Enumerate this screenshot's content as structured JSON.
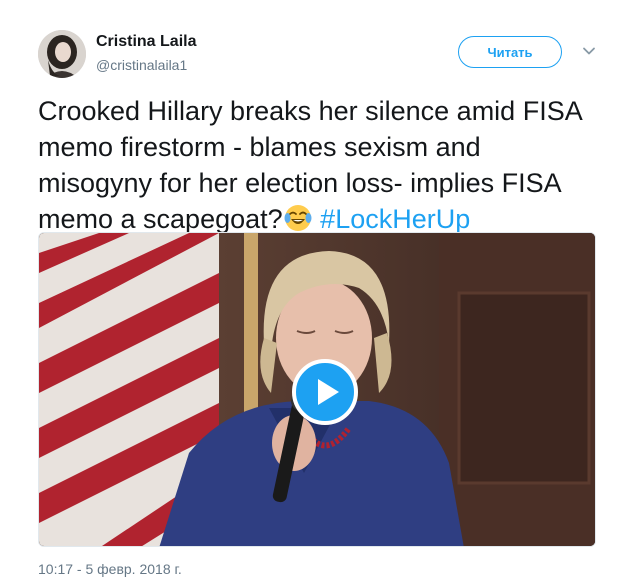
{
  "author": {
    "name": "Cristina Laila",
    "handle": "@cristinalaila1",
    "avatar_icon": "profile-photo"
  },
  "actions": {
    "follow_label": "Читать",
    "menu_icon": "chevron-down-icon"
  },
  "tweet": {
    "text": "Crooked Hillary breaks her silence amid FISA memo firestorm - blames sexism and misogyny for her election loss- implies FISA memo a scapegoat?",
    "emoji": "😂",
    "emoji_icon": "tears-of-joy-emoji",
    "hashtag": "#LockHerUp"
  },
  "media": {
    "type": "video",
    "play_icon": "play-icon"
  },
  "meta": {
    "timestamp": "10:17 - 5 февр. 2018 г."
  },
  "colors": {
    "accent": "#1da1f2",
    "text": "#14171a",
    "secondary": "#657786",
    "border": "#e1e8ed"
  }
}
